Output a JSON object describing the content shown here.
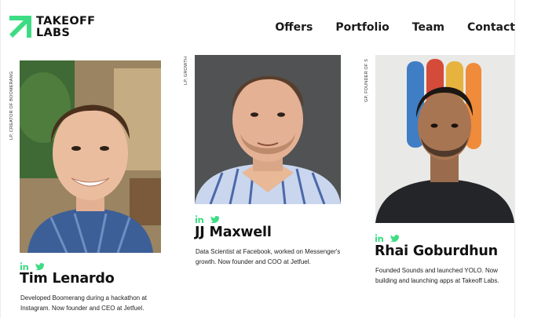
{
  "brand": {
    "line1": "TAKEOFF",
    "line2": "LABS",
    "accent": "#3ddc84"
  },
  "nav": {
    "items": [
      "Offers",
      "Portfolio",
      "Team",
      "Contact"
    ]
  },
  "team": [
    {
      "role": "LP, CREATOR OF BOOMERANG",
      "name": "Tim Lenardo",
      "bio": "Developed Boomerang during a hackathon at Instagram. Now founder and CEO at Jetfuel."
    },
    {
      "role": "LP, GROWTH",
      "name": "JJ Maxwell",
      "bio": "Data Scientist at Facebook, worked on Messenger's growth. Now founder and COO at Jetfuel."
    },
    {
      "role": "GP, FOUNDER OF S",
      "name": "Rhai Goburdhun",
      "bio": "Founded Sounds and launched YOLO. Now building and launching apps at Takeoff Labs."
    }
  ],
  "social_icons": [
    "linkedin-icon",
    "twitter-icon"
  ]
}
